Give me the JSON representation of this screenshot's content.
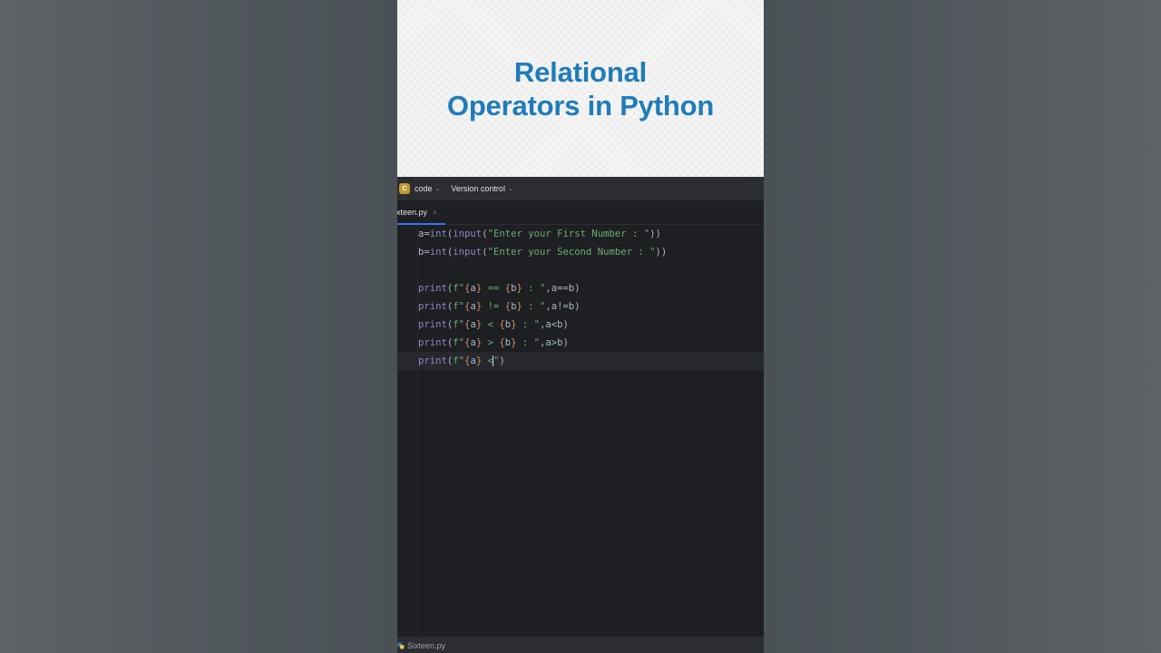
{
  "banner": {
    "line1": "Relational",
    "line2": "Operators in Python"
  },
  "title_bar": {
    "project_initial": "C",
    "project_name": "code",
    "vcs_label": "Version control"
  },
  "tab": {
    "label": "xteen.py",
    "close": "×"
  },
  "editor": {
    "lines": [
      {
        "parts": [
          [
            "a=",
            "fn"
          ],
          [
            "int",
            "builtin"
          ],
          [
            "(",
            "fn"
          ],
          [
            "input",
            "builtin"
          ],
          [
            "(",
            "fn"
          ],
          [
            "\"Enter your First Number : \"",
            "str"
          ],
          [
            "))",
            "fn"
          ]
        ]
      },
      {
        "parts": [
          [
            "b=",
            "fn"
          ],
          [
            "int",
            "builtin"
          ],
          [
            "(",
            "fn"
          ],
          [
            "input",
            "builtin"
          ],
          [
            "(",
            "fn"
          ],
          [
            "\"Enter your Second Number : \"",
            "str"
          ],
          [
            "))",
            "fn"
          ]
        ]
      },
      {
        "parts": []
      },
      {
        "parts": [
          [
            "print",
            "builtin"
          ],
          [
            "(",
            "fn"
          ],
          [
            "f\"",
            "str"
          ],
          [
            "{",
            "brace"
          ],
          [
            "a",
            "fn"
          ],
          [
            "}",
            "brace"
          ],
          [
            " == ",
            "str"
          ],
          [
            "{",
            "brace"
          ],
          [
            "b",
            "fn"
          ],
          [
            "}",
            "brace"
          ],
          [
            " : \"",
            "str"
          ],
          [
            ",a==b)",
            "fn"
          ]
        ]
      },
      {
        "parts": [
          [
            "print",
            "builtin"
          ],
          [
            "(",
            "fn"
          ],
          [
            "f\"",
            "str"
          ],
          [
            "{",
            "brace"
          ],
          [
            "a",
            "fn"
          ],
          [
            "}",
            "brace"
          ],
          [
            " != ",
            "str"
          ],
          [
            "{",
            "brace"
          ],
          [
            "b",
            "fn"
          ],
          [
            "}",
            "brace"
          ],
          [
            " : \"",
            "str"
          ],
          [
            ",a!=b)",
            "fn"
          ]
        ]
      },
      {
        "parts": [
          [
            "print",
            "builtin"
          ],
          [
            "(",
            "fn"
          ],
          [
            "f\"",
            "str"
          ],
          [
            "{",
            "brace"
          ],
          [
            "a",
            "fn"
          ],
          [
            "}",
            "brace"
          ],
          [
            " < ",
            "str"
          ],
          [
            "{",
            "brace"
          ],
          [
            "b",
            "fn"
          ],
          [
            "}",
            "brace"
          ],
          [
            " : \"",
            "str"
          ],
          [
            ",a<b)",
            "fn"
          ]
        ]
      },
      {
        "parts": [
          [
            "print",
            "builtin"
          ],
          [
            "(",
            "fn"
          ],
          [
            "f\"",
            "str"
          ],
          [
            "{",
            "brace"
          ],
          [
            "a",
            "fn"
          ],
          [
            "}",
            "brace"
          ],
          [
            " > ",
            "str"
          ],
          [
            "{",
            "brace"
          ],
          [
            "b",
            "fn"
          ],
          [
            "}",
            "brace"
          ],
          [
            " : \"",
            "str"
          ],
          [
            ",a>b)",
            "fn"
          ]
        ]
      },
      {
        "parts": [
          [
            "print",
            "builtin"
          ],
          [
            "(",
            "fn"
          ],
          [
            "f\"",
            "str"
          ],
          [
            "{",
            "brace"
          ],
          [
            "a",
            "fn"
          ],
          [
            "}",
            "brace"
          ],
          [
            " <",
            "str"
          ],
          [
            "|",
            "caret"
          ],
          [
            "\"",
            "str"
          ],
          [
            ")",
            "fn"
          ]
        ],
        "current": true
      }
    ]
  },
  "status_bar": {
    "file_name": "Sixteen.py"
  },
  "colors": {
    "banner_title": "#1f7cba",
    "editor_bg": "#1e1f22",
    "string": "#6aab73",
    "builtin": "#8888c6",
    "brace": "#cf8e6d",
    "tab_underline": "#3574f0"
  }
}
